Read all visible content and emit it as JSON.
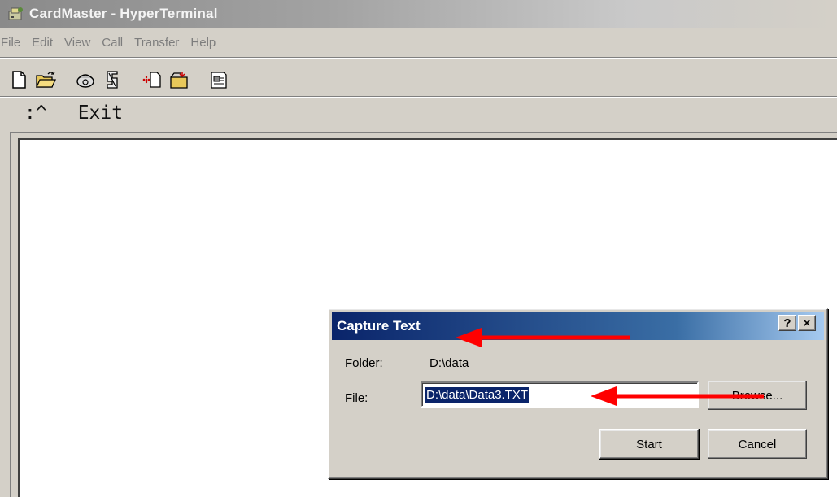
{
  "window": {
    "title": "CardMaster - HyperTerminal"
  },
  "menu": {
    "items": [
      "File",
      "Edit",
      "View",
      "Call",
      "Transfer",
      "Help"
    ]
  },
  "toolbar": {
    "icons": [
      "new-connection-icon",
      "open-icon",
      "connect-icon",
      "disconnect-icon",
      "send-icon",
      "receive-icon",
      "properties-icon"
    ]
  },
  "terminal": {
    "cursor_glyph": ":^",
    "line_text": "Exit"
  },
  "dialog": {
    "title": "Capture Text",
    "help_label": "?",
    "close_label": "×",
    "folder_label": "Folder:",
    "folder_value": "D:\\data",
    "file_label": "File:",
    "file_value": "D:\\data\\Data3.TXT",
    "browse_label": "Browse...",
    "start_label": "Start",
    "cancel_label": "Cancel"
  },
  "annotations": {
    "arrow_color": "#ff0000"
  }
}
